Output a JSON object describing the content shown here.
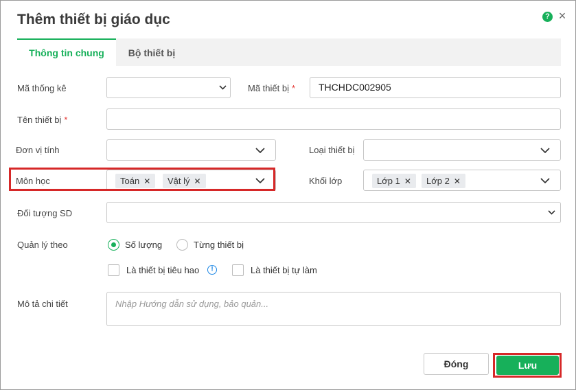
{
  "dialog": {
    "title": "Thêm thiết bị giáo dục",
    "help_glyph": "?",
    "close_glyph": "×"
  },
  "tabs": [
    {
      "label": "Thông tin chung",
      "active": true
    },
    {
      "label": "Bộ thiết bị",
      "active": false
    }
  ],
  "form": {
    "ma_thong_ke": {
      "label": "Mã thống kê",
      "value": ""
    },
    "ma_thiet_bi": {
      "label": "Mã thiết bị",
      "required_mark": "*",
      "value": "THCHDC002905"
    },
    "ten_thiet_bi": {
      "label": "Tên thiết bị",
      "required_mark": "*",
      "value": ""
    },
    "don_vi_tinh": {
      "label": "Đơn vị tính",
      "value": ""
    },
    "loai_thiet_bi": {
      "label": "Loại thiết bị",
      "value": ""
    },
    "mon_hoc": {
      "label": "Môn học",
      "tags": [
        "Toán",
        "Vật lý"
      ]
    },
    "khoi_lop": {
      "label": "Khối lớp",
      "tags": [
        "Lớp 1",
        "Lớp 2"
      ]
    },
    "doi_tuong_sd": {
      "label": "Đối tượng SD",
      "value": ""
    },
    "quan_ly_theo": {
      "label": "Quản lý theo",
      "options": [
        {
          "label": "Số lượng",
          "selected": true
        },
        {
          "label": "Từng thiết bị",
          "selected": false
        }
      ]
    },
    "checkboxes": [
      {
        "label": "Là thiết bị tiêu hao",
        "checked": false
      },
      {
        "label": "Là thiết bị tự làm",
        "checked": false
      }
    ],
    "mo_ta": {
      "label": "Mô tả chi tiết",
      "placeholder": "Nhập Hướng dẫn sử dụng, bảo quản...",
      "value": ""
    }
  },
  "tag_remove_glyph": "✕",
  "info_glyph": "!",
  "buttons": {
    "close_label": "Đóng",
    "save_label": "Lưu"
  },
  "colors": {
    "accent": "#17b05a",
    "highlight": "#d62828",
    "required": "#e53935",
    "info": "#1e88e5"
  }
}
